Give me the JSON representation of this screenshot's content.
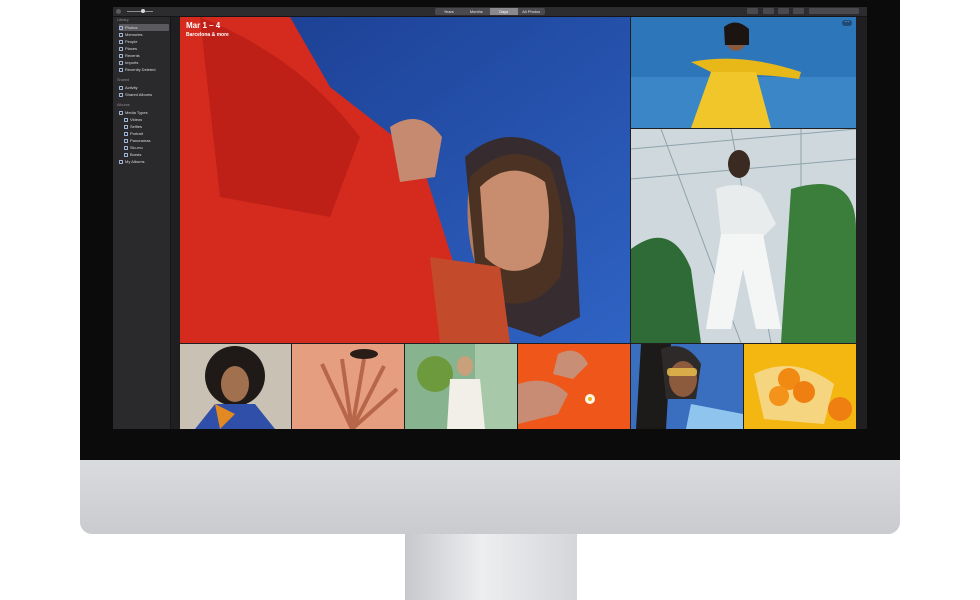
{
  "toolbar": {
    "view_tabs": [
      {
        "label": "Years",
        "active": false
      },
      {
        "label": "Months",
        "active": false
      },
      {
        "label": "Days",
        "active": true
      },
      {
        "label": "All Photos",
        "active": false
      }
    ]
  },
  "sidebar": {
    "library_header": "Library",
    "library_items": [
      "Photos",
      "Memories",
      "People",
      "Places",
      "Recents",
      "Imports",
      "Recently Deleted"
    ],
    "shared_header": "Shared",
    "shared_items": [
      "Activity",
      "Shared Albums"
    ],
    "albums_header": "Albums",
    "album_items": [
      "Media Types",
      "Videos",
      "Selfies",
      "Portrait",
      "Panoramas",
      "Slo-mo",
      "Bursts",
      "My Albums"
    ],
    "selected": "Photos"
  },
  "moment": {
    "title": "Mar 1 – 4",
    "subtitle": "Barcelona & more"
  },
  "photos": [
    {
      "name": "hero-red-sweater",
      "dominant_color": "#d42b1e"
    },
    {
      "name": "yellow-dress",
      "dominant_color": "#e8b818"
    },
    {
      "name": "greenhouse-white-outfit",
      "dominant_color": "#e9ecec"
    },
    {
      "name": "curly-hair-portrait",
      "dominant_color": "#2b2b2b"
    },
    {
      "name": "shadow-eye-closeup",
      "dominant_color": "#e69e80"
    },
    {
      "name": "woman-with-plant",
      "dominant_color": "#87b38e"
    },
    {
      "name": "hands-on-orange",
      "dominant_color": "#ef5619"
    },
    {
      "name": "sunglasses-portrait",
      "dominant_color": "#2f2a2a"
    },
    {
      "name": "oranges-in-net-bag",
      "dominant_color": "#f4b712"
    }
  ],
  "colors": {
    "accent_selection": "#5a5a5f",
    "sidebar_bg": "#2a2a2c",
    "screen_bg": "#1f1f21"
  },
  "hardware": {
    "logo": "apple-logo-icon"
  }
}
